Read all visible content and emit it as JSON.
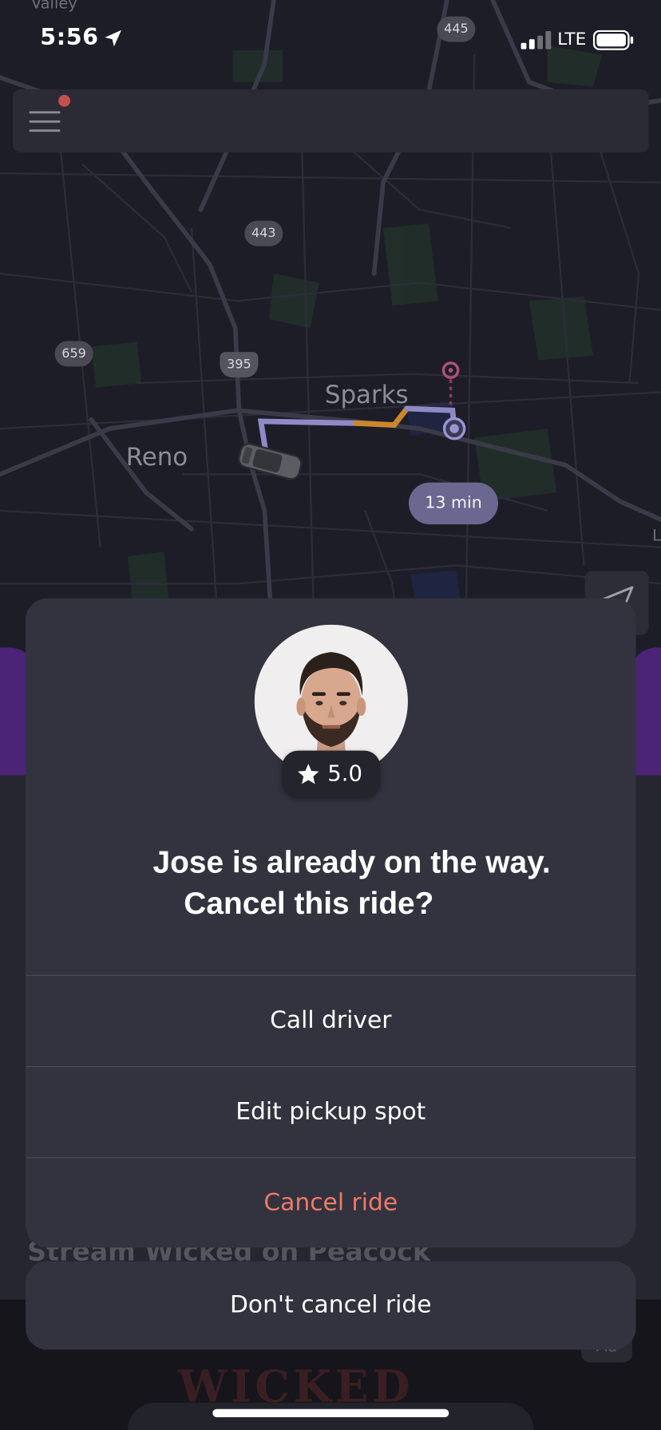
{
  "status_bar": {
    "time": "5:56",
    "network": "LTE",
    "icons": [
      "location-arrow-icon",
      "signal-bars-icon",
      "battery-icon"
    ]
  },
  "map": {
    "labels": {
      "top_left": "Valley",
      "city_a": "Reno",
      "city_b": "Sparks",
      "edge": "L"
    },
    "shields": [
      "445",
      "443",
      "659",
      "395"
    ],
    "eta": "13 min",
    "colors": {
      "route": "#8f8ac6",
      "traffic": "#c8882b",
      "pickup": "#b04f7b"
    }
  },
  "top_bar": {
    "menu_icon": "hamburger-menu-icon",
    "notification_color": "#c4504e"
  },
  "background": {
    "promo_text": "Stream Wicked on Peacock",
    "ad_badge": "Ad",
    "ad_art_text": "WICKED"
  },
  "dialog": {
    "driver_rating": "5.0",
    "title_line1": "Jose is already on the way.",
    "title_line2": "Cancel this ride?",
    "actions": {
      "call": "Call driver",
      "edit": "Edit pickup spot",
      "cancel": "Cancel ride"
    },
    "dont_cancel": "Don't cancel ride",
    "colors": {
      "surface": "#33333f",
      "destructive": "#ef7a66"
    }
  }
}
